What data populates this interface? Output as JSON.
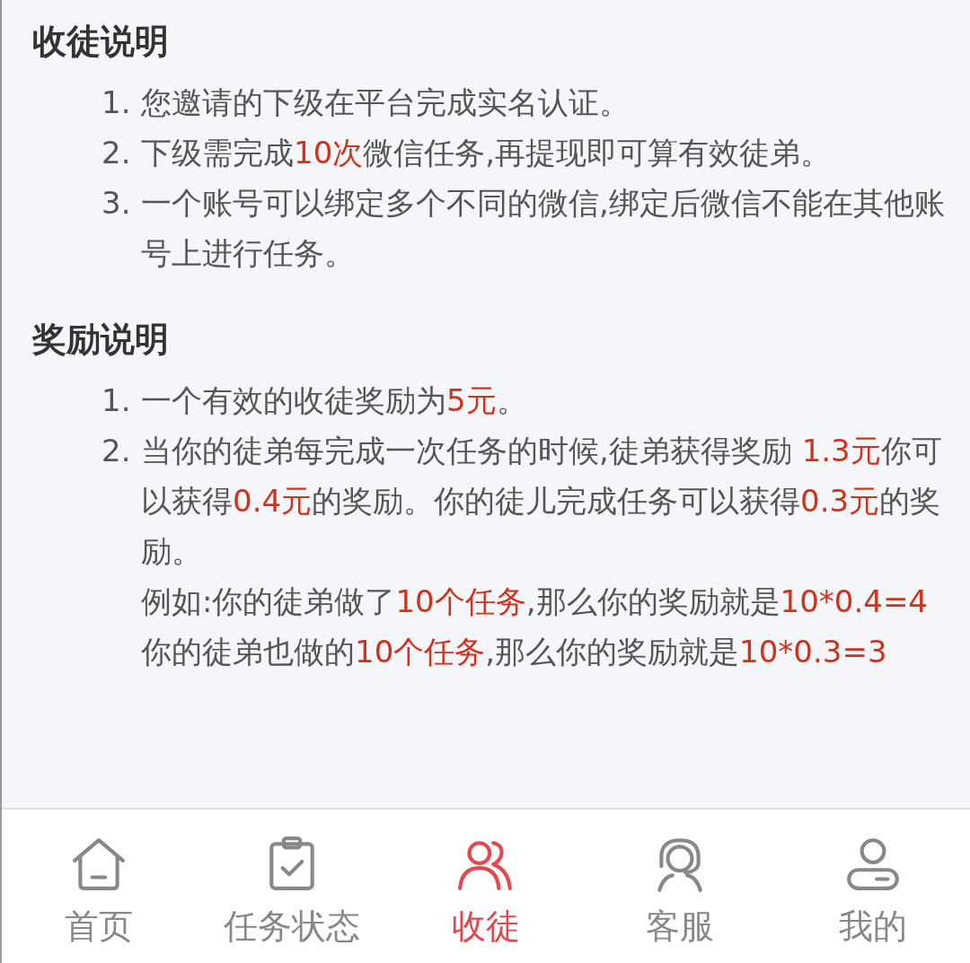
{
  "sections": [
    {
      "title": "收徒说明",
      "items": [
        {
          "number": "1.",
          "paragraphs": [
            [
              {
                "text": "您邀请的下级在平台完成实名认证。",
                "highlight": false
              }
            ]
          ]
        },
        {
          "number": "2.",
          "paragraphs": [
            [
              {
                "text": "下级需完成",
                "highlight": false
              },
              {
                "text": "10次",
                "highlight": true
              },
              {
                "text": "微信任务,再提现即可算有效徒弟。",
                "highlight": false
              }
            ]
          ]
        },
        {
          "number": "3.",
          "paragraphs": [
            [
              {
                "text": "一个账号可以绑定多个不同的微信,绑定后微信不能在其他账号上进行任务。",
                "highlight": false
              }
            ]
          ]
        }
      ]
    },
    {
      "title": "奖励说明",
      "items": [
        {
          "number": "1.",
          "paragraphs": [
            [
              {
                "text": "一个有效的收徒奖励为",
                "highlight": false
              },
              {
                "text": "5元",
                "highlight": true
              },
              {
                "text": "。",
                "highlight": false
              }
            ]
          ]
        },
        {
          "number": "2.",
          "paragraphs": [
            [
              {
                "text": "当你的徒弟每完成一次任务的时候,徒弟获得奖励 ",
                "highlight": false
              },
              {
                "text": "1.3元",
                "highlight": true
              },
              {
                "text": "你可以获得",
                "highlight": false
              },
              {
                "text": "0.4元",
                "highlight": true
              },
              {
                "text": "的奖励。你的徒儿完成任务可以获得",
                "highlight": false
              },
              {
                "text": "0.3元",
                "highlight": true
              },
              {
                "text": "的奖励。",
                "highlight": false
              }
            ],
            [
              {
                "text": "例如:你的徒弟做了",
                "highlight": false
              },
              {
                "text": "10个任务",
                "highlight": true
              },
              {
                "text": ",那么你的奖励就是",
                "highlight": false
              },
              {
                "text": "10*0.4=4",
                "highlight": true
              }
            ],
            [
              {
                "text": "你的徒弟也做的",
                "highlight": false
              },
              {
                "text": "10个任务",
                "highlight": true
              },
              {
                "text": ",那么你的奖励就是",
                "highlight": false
              },
              {
                "text": "10*0.3=3",
                "highlight": true
              }
            ]
          ]
        }
      ]
    }
  ],
  "tab_bar": [
    {
      "kind": "home",
      "label": "首页",
      "selected": false
    },
    {
      "kind": "tasks",
      "label": "任务状态",
      "selected": false
    },
    {
      "kind": "invite",
      "label": "收徒",
      "selected": true
    },
    {
      "kind": "service",
      "label": "客服",
      "selected": false
    },
    {
      "kind": "profile",
      "label": "我的",
      "selected": false
    }
  ]
}
